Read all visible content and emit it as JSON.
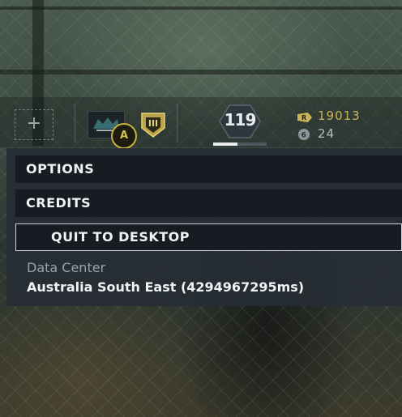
{
  "top_bar": {
    "add_slot_symbol": "+",
    "rank_badge_text": "A",
    "shield_text": "III",
    "level": "119",
    "level_progress": 0.45,
    "renown": "19013",
    "r6_credits": "24",
    "currency_icons": [
      "renown-icon",
      "r6-credits-icon"
    ]
  },
  "menu": {
    "items": [
      {
        "label": "OPTIONS"
      },
      {
        "label": "CREDITS"
      },
      {
        "label": "QUIT TO DESKTOP",
        "selected": true
      }
    ]
  },
  "data_center": {
    "label": "Data Center",
    "value": "Australia South East (4294967295ms)"
  },
  "colors": {
    "accent_gold": "#c9b458",
    "panel_bg": "#262d34",
    "button_bg": "#181c22",
    "text_primary": "#f0f2f4",
    "text_muted": "#9aa3ab"
  }
}
